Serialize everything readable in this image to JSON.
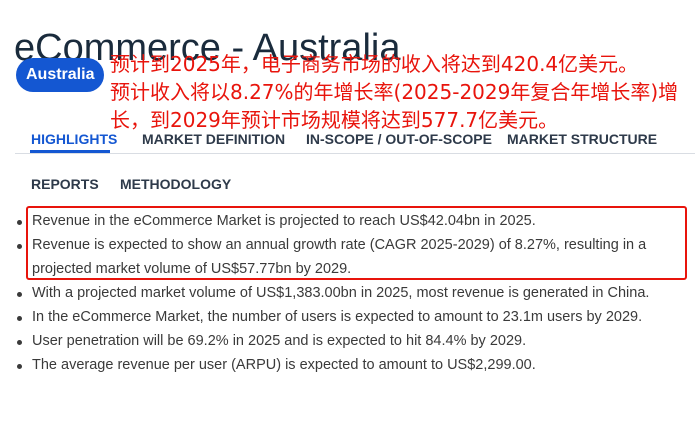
{
  "header": {
    "title": "eCommerce - Australia",
    "badge": "Australia"
  },
  "annotation": {
    "lines": [
      "预计到2025年，电子商务市场的收入将达到420.4亿美元。",
      "预计收入将以8.27%的年增长率(2025-2029年复合年增长率)增",
      "长，到2029年预计市场规模将达到577.7亿美元。"
    ],
    "color": "#e8140c"
  },
  "tabs": {
    "row1": [
      "HIGHLIGHTS",
      "MARKET DEFINITION",
      "IN-SCOPE / OUT-OF-SCOPE",
      "MARKET STRUCTURE"
    ],
    "row2": [
      "REPORTS",
      "METHODOLOGY"
    ],
    "active": "HIGHLIGHTS"
  },
  "highlights": [
    "Revenue in the eCommerce Market is projected to reach US$42.04bn in 2025.",
    "Revenue is expected to show an annual growth rate (CAGR 2025-2029) of 8.27%, resulting in a projected market volume of US$57.77bn by 2029.",
    "With a projected market volume of US$1,383.00bn in 2025, most revenue is generated in China.",
    "In the eCommerce Market, the number of users is expected to amount to 23.1m users by 2029.",
    "User penetration will be 69.2% in 2025 and is expected to hit 84.4% by 2029.",
    "The average revenue per user (ARPU) is expected to amount to US$2,299.00."
  ],
  "colors": {
    "accent": "#1457d2",
    "highlight_box": "#e8140c"
  }
}
